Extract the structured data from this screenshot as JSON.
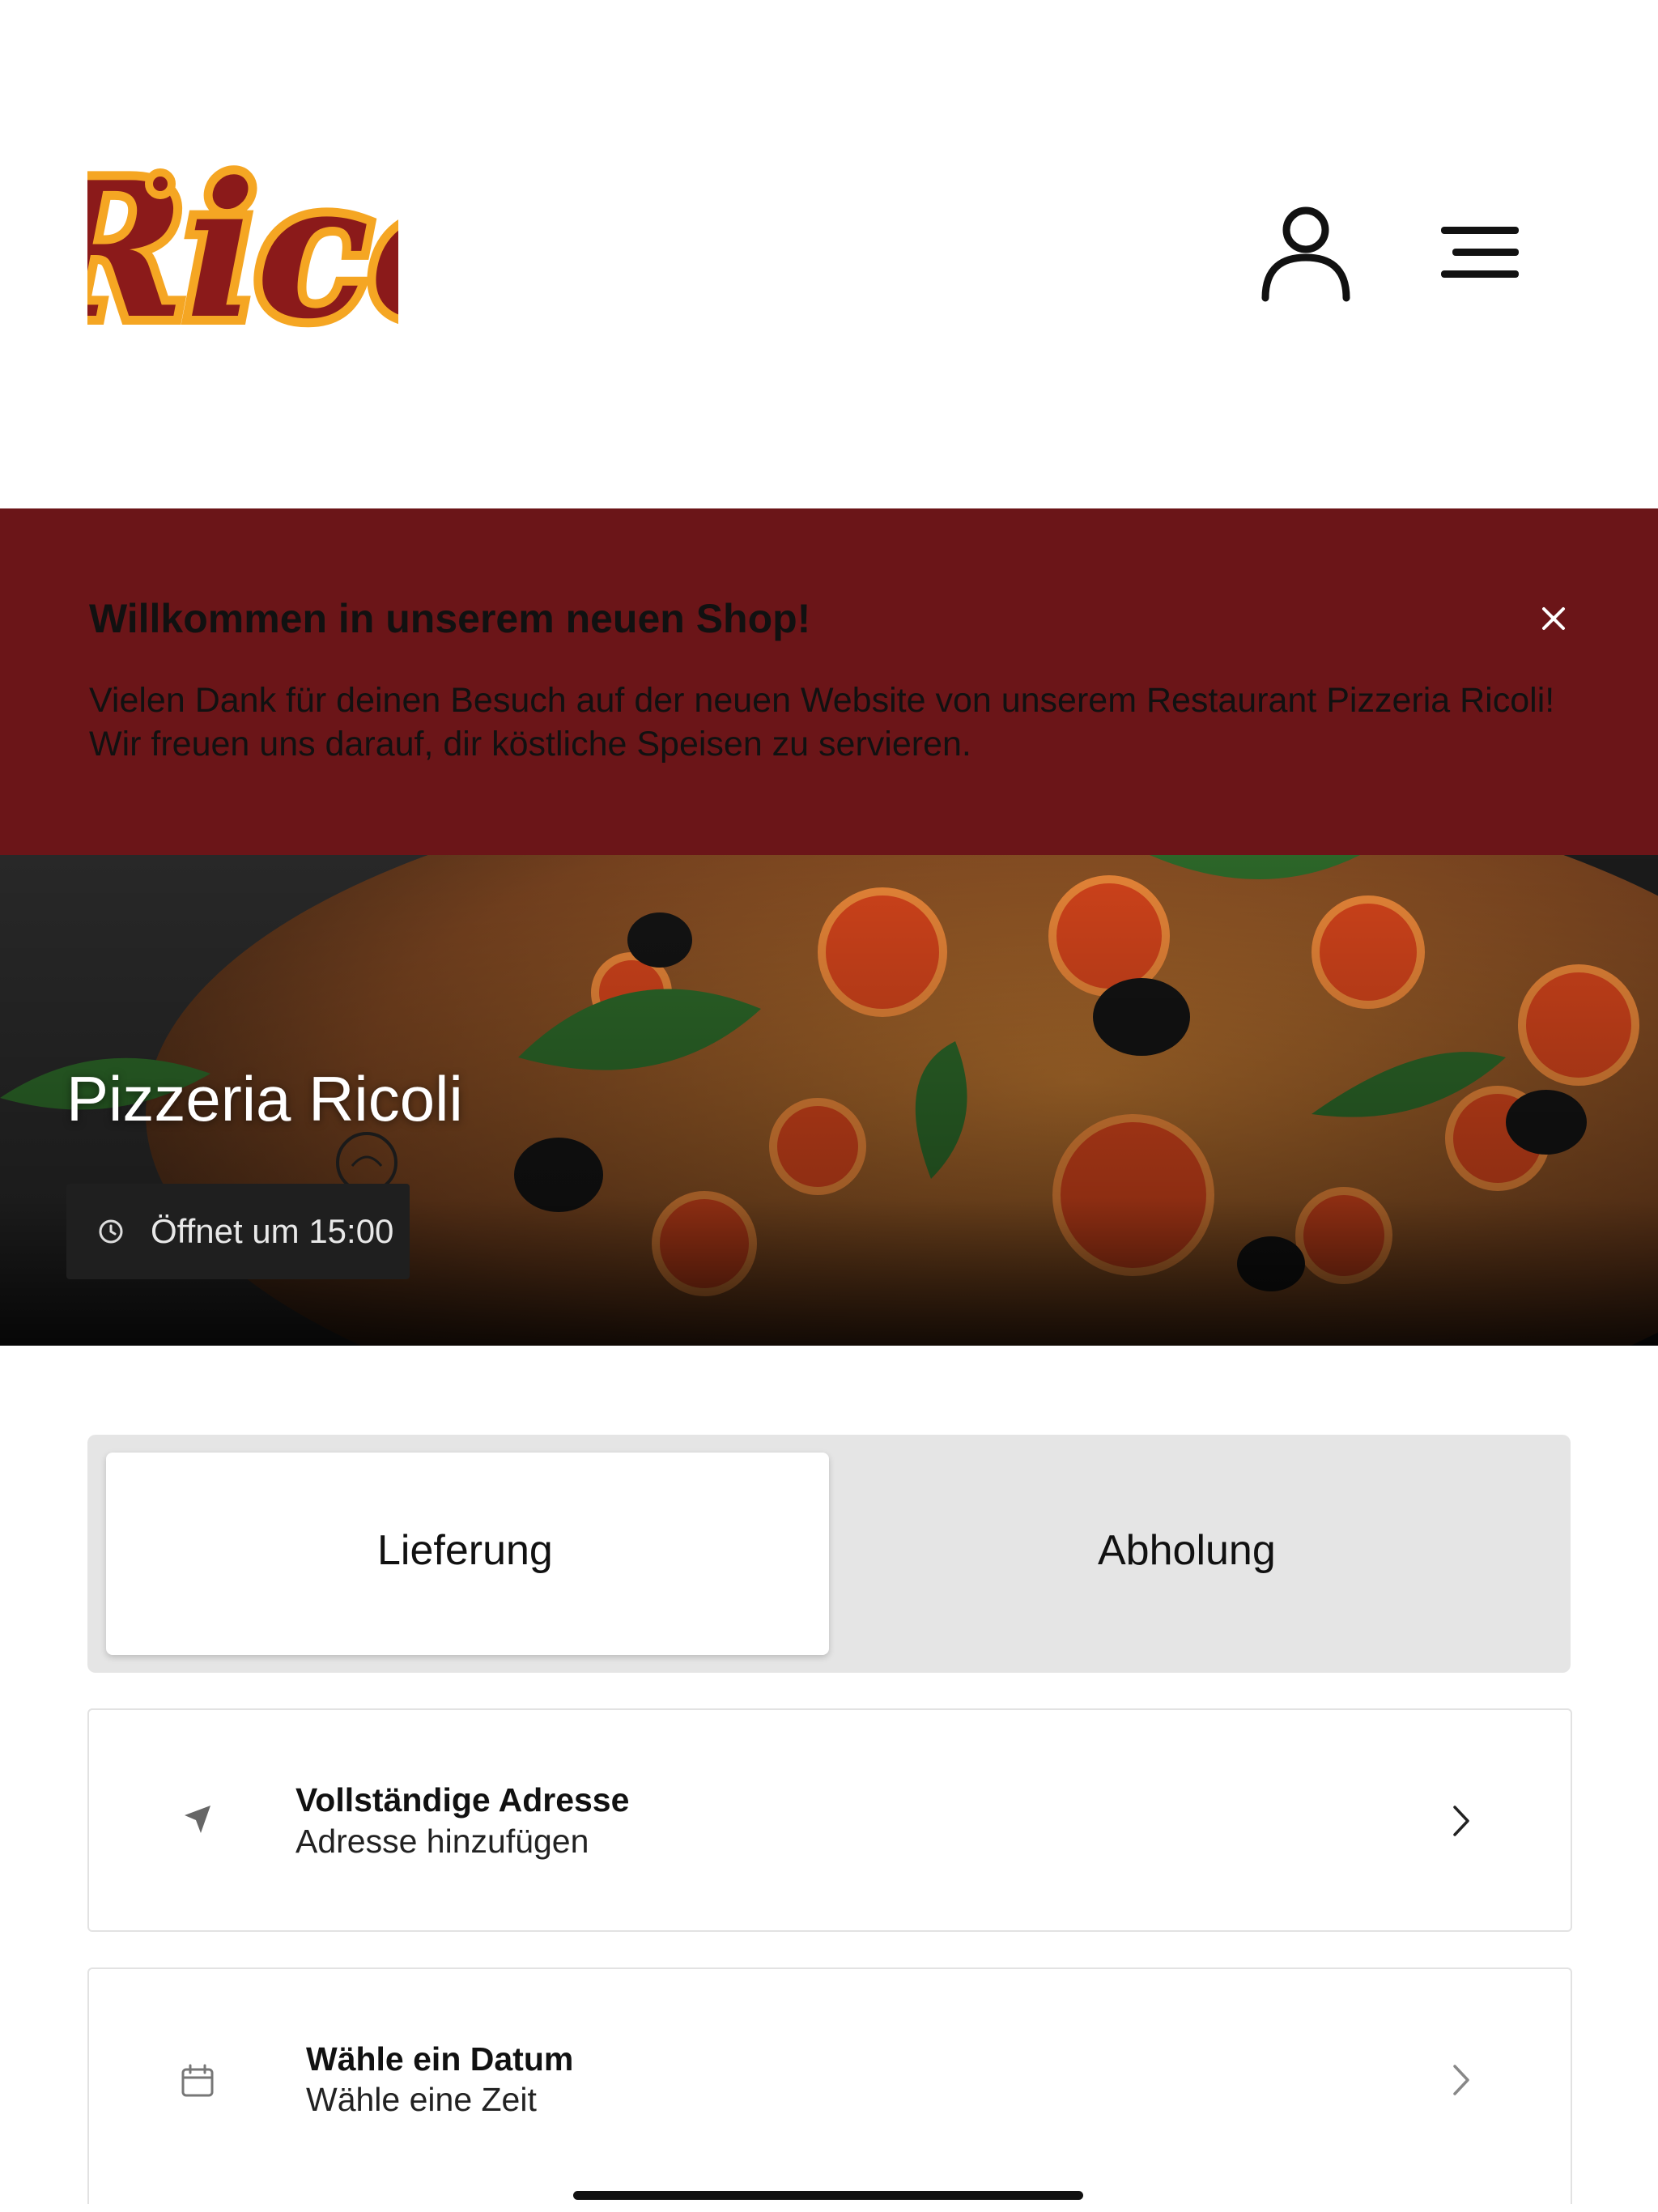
{
  "logo": {
    "text": "Ricoli",
    "colors": {
      "primary": "#8b1a1a",
      "accent": "#f5a623"
    }
  },
  "header": {
    "user_icon": "user-icon",
    "menu_icon": "hamburger-menu-icon"
  },
  "banner": {
    "title": "Willkommen in unserem neuen Shop!",
    "line1": "Vielen Dank für deinen Besuch auf der neuen Website von unserem Restaurant Pizzeria Ricoli!",
    "line2": "Wir freuen uns darauf, dir köstliche Speisen zu servieren.",
    "background": "#6b1518"
  },
  "hero": {
    "title": "Pizzeria Ricoli",
    "hours": "Öffnet um 15:00"
  },
  "tabs": [
    {
      "label": "Lieferung",
      "selected": true
    },
    {
      "label": "Abholung",
      "selected": false
    }
  ],
  "address_card": {
    "title": "Vollständige Adresse",
    "subtitle": "Adresse hinzufügen",
    "icon": "location-arrow-icon"
  },
  "date_card": {
    "title": "Wähle ein Datum",
    "subtitle": "Wähle eine Zeit",
    "icon": "calendar-icon"
  }
}
